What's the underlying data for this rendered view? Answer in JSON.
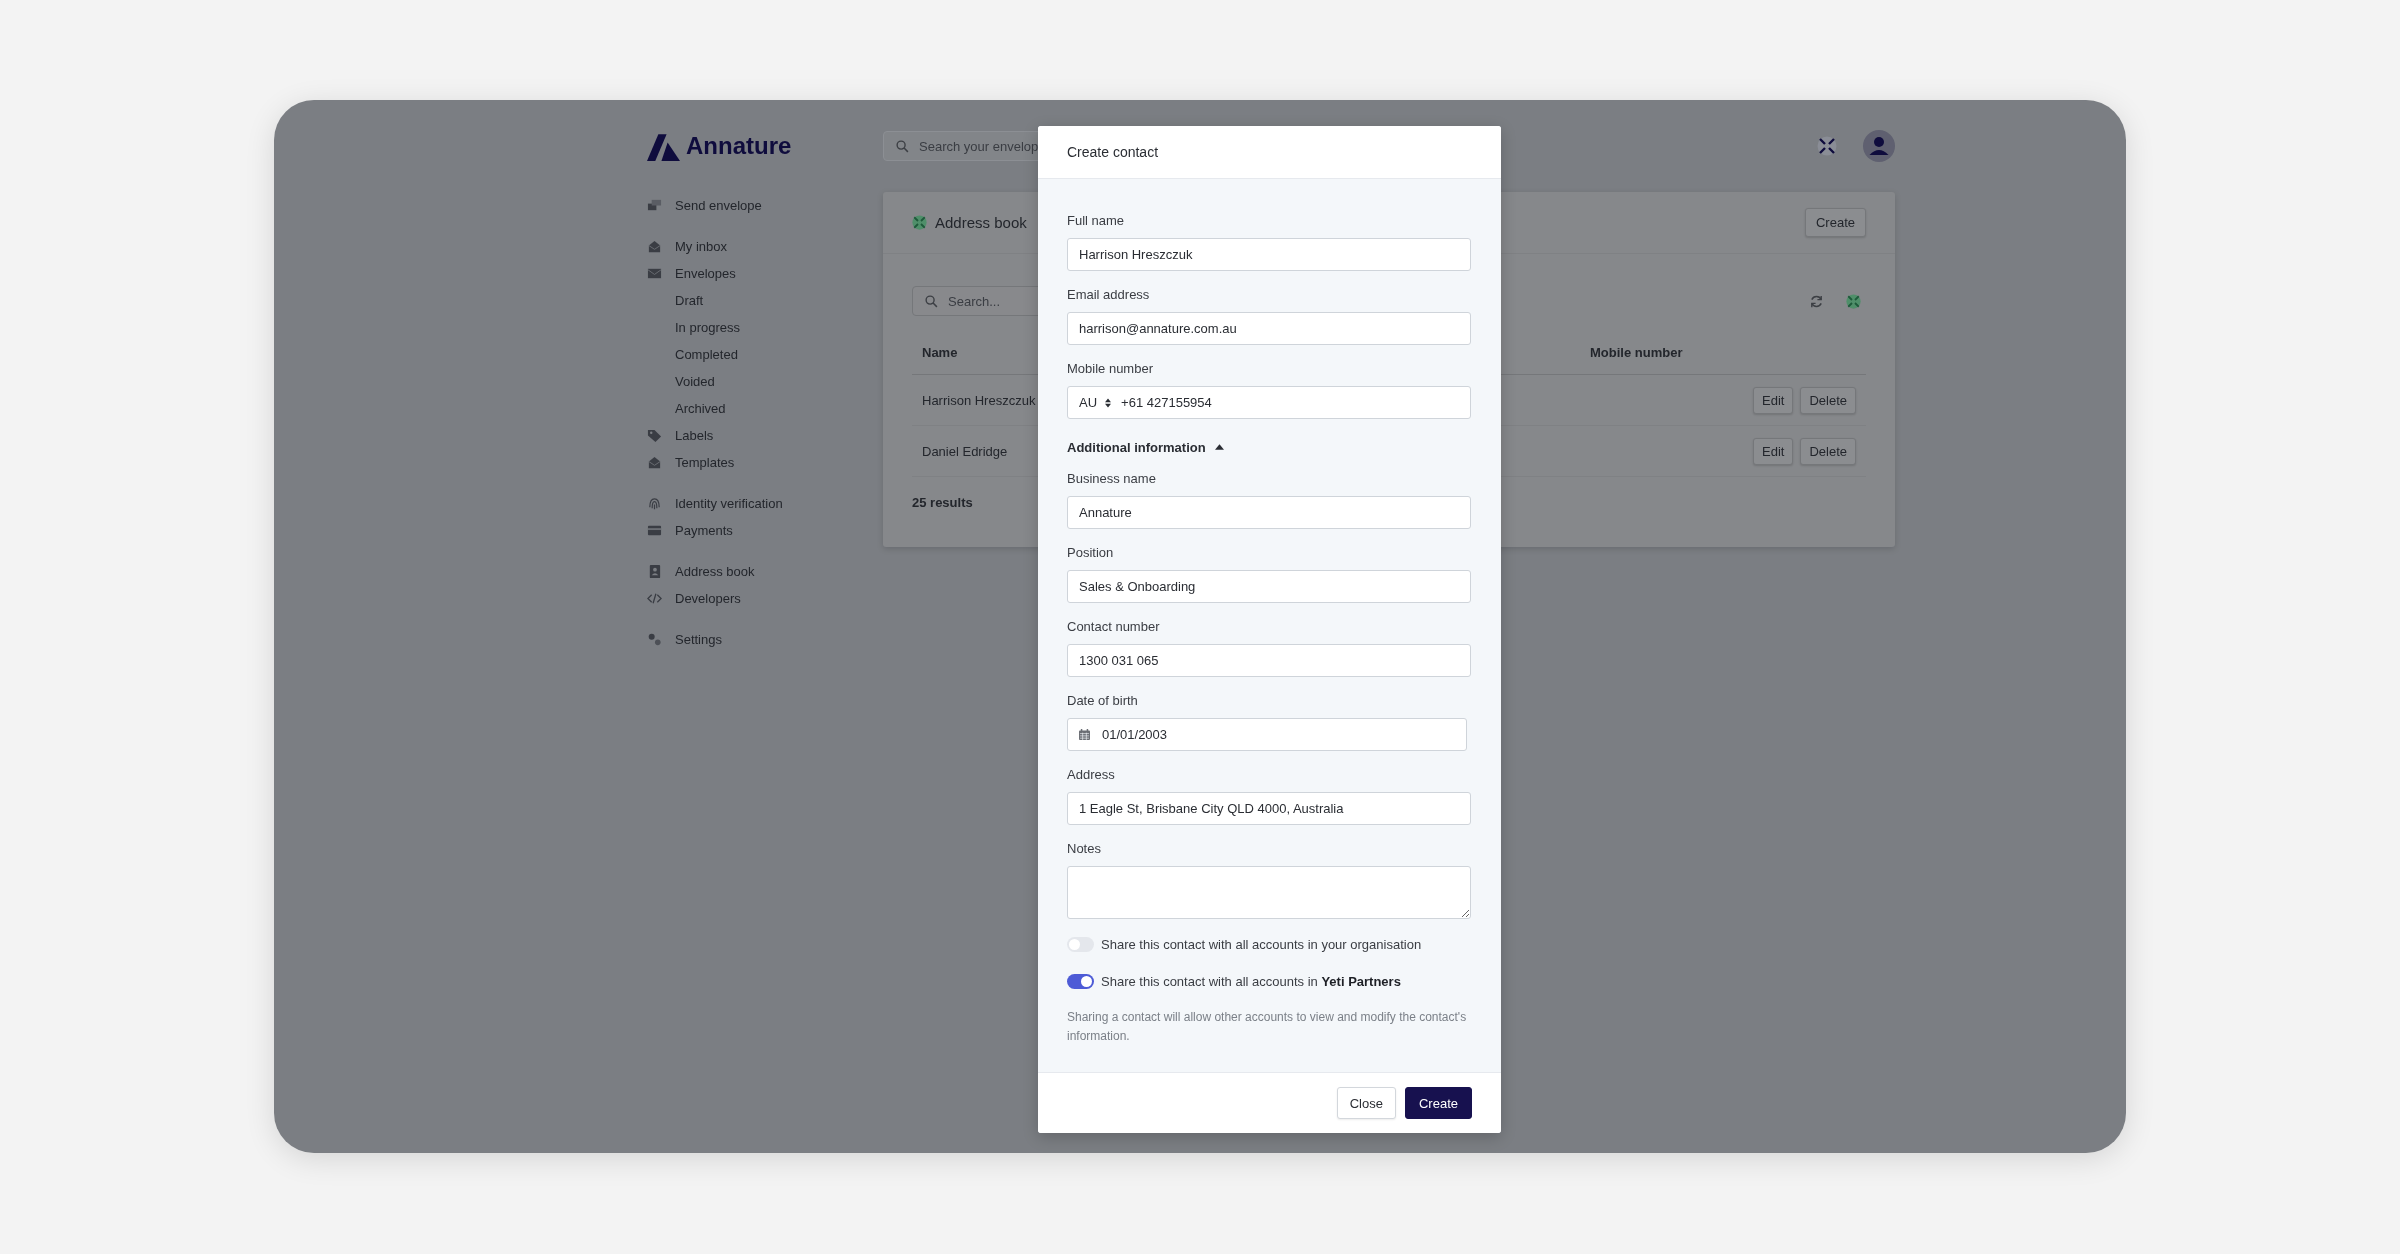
{
  "topbar": {
    "logo": "Annature",
    "search": {
      "placeholder": "Search your envelop"
    }
  },
  "sidebar": {
    "groups": [
      [
        {
          "label": "Send envelope",
          "kind": "send"
        }
      ],
      [
        {
          "label": "My inbox",
          "kind": "inbox"
        },
        {
          "label": "Envelopes",
          "kind": "envelope",
          "children": [
            {
              "label": "Draft"
            },
            {
              "label": "In progress"
            },
            {
              "label": "Completed"
            },
            {
              "label": "Voided"
            },
            {
              "label": "Archived"
            }
          ]
        },
        {
          "label": "Labels",
          "kind": "tag"
        },
        {
          "label": "Templates",
          "kind": "inbox"
        }
      ],
      [
        {
          "label": "Identity verification",
          "kind": "fingerprint"
        },
        {
          "label": "Payments",
          "kind": "card"
        }
      ],
      [
        {
          "label": "Address book",
          "kind": "contact"
        },
        {
          "label": "Developers",
          "kind": "code"
        }
      ],
      [
        {
          "label": "Settings",
          "kind": "gears"
        }
      ]
    ]
  },
  "panel": {
    "title": "Address book",
    "create_button": "Create",
    "search": {
      "placeholder": "Search..."
    },
    "table": {
      "columns": [
        "Name",
        "Mobile number"
      ],
      "rows": [
        {
          "name": "Harrison Hreszczuk",
          "actions": [
            "Edit",
            "Delete"
          ]
        },
        {
          "name": "Daniel Edridge",
          "actions": [
            "Edit",
            "Delete"
          ]
        }
      ]
    },
    "results": "25 results"
  },
  "modal": {
    "title": "Create contact",
    "fields": [
      {
        "kind": "text",
        "label": "Full name",
        "value": "Harrison Hreszczuk"
      },
      {
        "kind": "text",
        "label": "Email address",
        "value": "harrison@annature.com.au"
      },
      {
        "kind": "phone",
        "label": "Mobile number",
        "country": "AU",
        "value": "+61 427155954"
      }
    ],
    "additional": {
      "label": "Additional information",
      "expanded": true,
      "fields": [
        {
          "kind": "text",
          "label": "Business name",
          "value": "Annature"
        },
        {
          "kind": "text",
          "label": "Position",
          "value": "Sales & Onboarding"
        },
        {
          "kind": "text",
          "label": "Contact number",
          "value": "1300 031 065"
        },
        {
          "kind": "date",
          "label": "Date of birth",
          "value": "01/01/2003"
        },
        {
          "kind": "text",
          "label": "Address",
          "value": "1 Eagle St, Brisbane City QLD 4000, Australia"
        },
        {
          "kind": "textarea",
          "label": "Notes"
        }
      ]
    },
    "toggles": [
      {
        "label": "Share this contact with all accounts in your organisation",
        "on": false
      },
      {
        "label": "Share this contact with all accounts in **Yeti Partners**",
        "on": true
      }
    ],
    "note": "Sharing a contact will allow other accounts to view and modify the contact's information.",
    "buttons": [
      {
        "label": "Close",
        "kind": "secondary"
      },
      {
        "label": "Create",
        "kind": "primary"
      }
    ]
  }
}
